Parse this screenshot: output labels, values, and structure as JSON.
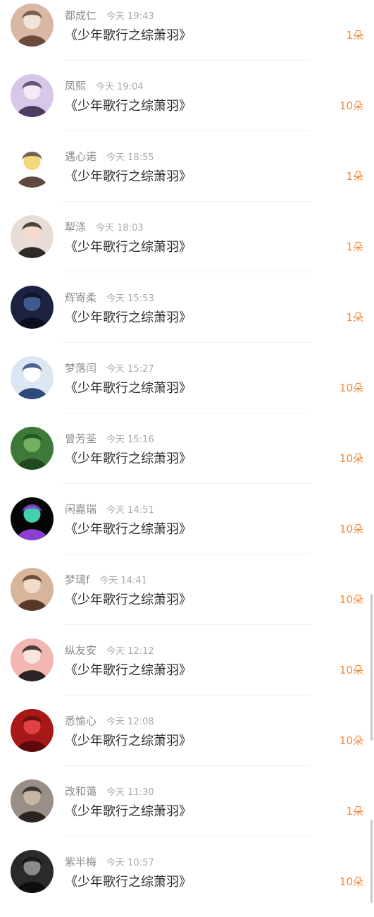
{
  "gift_list": [
    {
      "name": "都成仁",
      "time": "今天 19:43",
      "book": "《少年歌行之综萧羽》",
      "count": "1朵",
      "avatar": "avatar-flower-girl",
      "colors": [
        "#d9b8a3",
        "#6b4a3a",
        "#f1e5da"
      ]
    },
    {
      "name": "凤熙",
      "time": "今天 19:04",
      "book": "《少年歌行之综萧羽》",
      "count": "10朵",
      "avatar": "avatar-anime-girl-purple",
      "colors": [
        "#d7c7e8",
        "#4d3c63",
        "#f4e9f4"
      ]
    },
    {
      "name": "遇心诺",
      "time": "今天 18:55",
      "book": "《少年歌行之综萧羽》",
      "count": "1朵",
      "avatar": "avatar-hat-character",
      "colors": [
        "#ffffff",
        "#5e4a40",
        "#f3d77a"
      ]
    },
    {
      "name": "犁涤",
      "time": "今天 18:03",
      "book": "《少年歌行之综萧羽》",
      "count": "1朵",
      "avatar": "avatar-girl-selfie",
      "colors": [
        "#e8ddd6",
        "#2f2a28",
        "#f4d9cc"
      ]
    },
    {
      "name": "辉寄柔",
      "time": "今天 15:53",
      "book": "《少年歌行之综萧羽》",
      "count": "1朵",
      "avatar": "avatar-boy-dark",
      "colors": [
        "#1b2340",
        "#0c0f1f",
        "#3f5b8c"
      ]
    },
    {
      "name": "梦落闫",
      "time": "今天 15:27",
      "book": "《少年歌行之综萧羽》",
      "count": "10朵",
      "avatar": "avatar-anime-girl-blue",
      "colors": [
        "#dbe6f2",
        "#2e4a7a",
        "#ffffff"
      ]
    },
    {
      "name": "曾芳荃",
      "time": "今天 15:16",
      "book": "《少年歌行之综萧羽》",
      "count": "10朵",
      "avatar": "avatar-green-leaves",
      "colors": [
        "#3d7a3a",
        "#1f4a1e",
        "#74b060"
      ]
    },
    {
      "name": "闲嘉瑞",
      "time": "今天 14:51",
      "book": "《少年歌行之综萧羽》",
      "count": "10朵",
      "avatar": "avatar-neon-flower",
      "colors": [
        "#050505",
        "#8a3fd1",
        "#3fd1b0"
      ]
    },
    {
      "name": "梦璃f",
      "time": "今天 14:41",
      "book": "《少年歌行之综萧羽》",
      "count": "10朵",
      "avatar": "avatar-girl-warm",
      "colors": [
        "#d7b59a",
        "#5a3826",
        "#f0dccc"
      ]
    },
    {
      "name": "纵友安",
      "time": "今天 12:12",
      "book": "《少年歌行之综萧羽》",
      "count": "10朵",
      "avatar": "avatar-girl-pink",
      "colors": [
        "#f2b7b0",
        "#2b2222",
        "#fbe4df"
      ]
    },
    {
      "name": "悉愉心",
      "time": "今天 12:08",
      "book": "《少年歌行之综萧羽》",
      "count": "10朵",
      "avatar": "avatar-red-badge",
      "colors": [
        "#a81818",
        "#5c0a0a",
        "#e04040"
      ]
    },
    {
      "name": "改和蔼",
      "time": "今天 11:30",
      "book": "《少年歌行之综萧羽》",
      "count": "1朵",
      "avatar": "avatar-girl-teddy",
      "colors": [
        "#9a8f88",
        "#2a2322",
        "#c9b7a6"
      ]
    },
    {
      "name": "紫半梅",
      "time": "今天 10:57",
      "book": "《少年歌行之综萧羽》",
      "count": "10朵",
      "avatar": "avatar-monochrome-person",
      "colors": [
        "#2a2a2a",
        "#0e0e0e",
        "#8a8a8a"
      ]
    }
  ],
  "theme": {
    "count_color": "#f08a3c",
    "name_color": "#8c8c8c",
    "title_color": "#2b2b2b"
  }
}
